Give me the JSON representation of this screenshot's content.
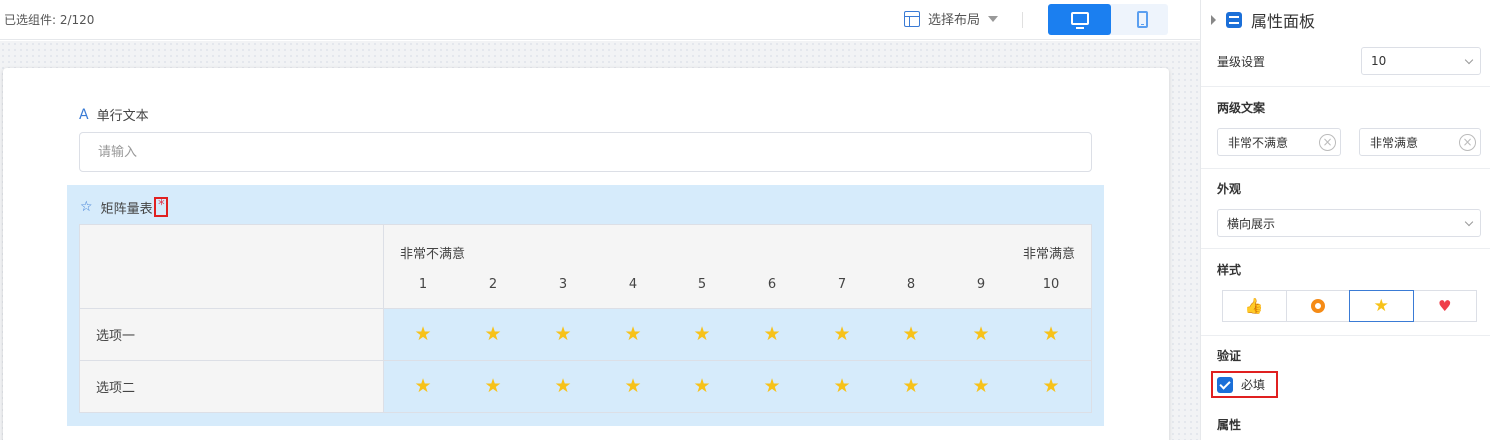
{
  "toolbar": {
    "selected_count": "已选组件:  2/120",
    "layout_select_label": "选择布局"
  },
  "form": {
    "single_line": {
      "label": "单行文本",
      "placeholder": "请输入"
    },
    "matrix": {
      "label": "矩阵量表",
      "required_mark": "*",
      "scale_low_label": "非常不满意",
      "scale_high_label": "非常满意",
      "scale": [
        "1",
        "2",
        "3",
        "4",
        "5",
        "6",
        "7",
        "8",
        "9",
        "10"
      ],
      "rows": [
        {
          "label": "选项一"
        },
        {
          "label": "选项二"
        }
      ],
      "icon": "star-icon",
      "star_color": "#f7c21a"
    }
  },
  "panel": {
    "title": "属性面板",
    "level_setting": {
      "label": "量级设置",
      "value": "10"
    },
    "two_level_text": {
      "label": "两级文案",
      "low": "非常不满意",
      "high": "非常满意"
    },
    "appearance": {
      "label": "外观",
      "value": "横向展示"
    },
    "style": {
      "label": "样式",
      "options": [
        "thumb-icon",
        "ring-icon",
        "star-icon",
        "heart-icon"
      ],
      "selected": "star-icon"
    },
    "validation": {
      "label": "验证",
      "required_label": "必填",
      "required_checked": true
    },
    "attributes": {
      "label": "属性"
    }
  },
  "colors": {
    "accent": "#1b7ff0",
    "matrix_bg": "#d6ebfb",
    "highlight_border": "#e02020"
  }
}
